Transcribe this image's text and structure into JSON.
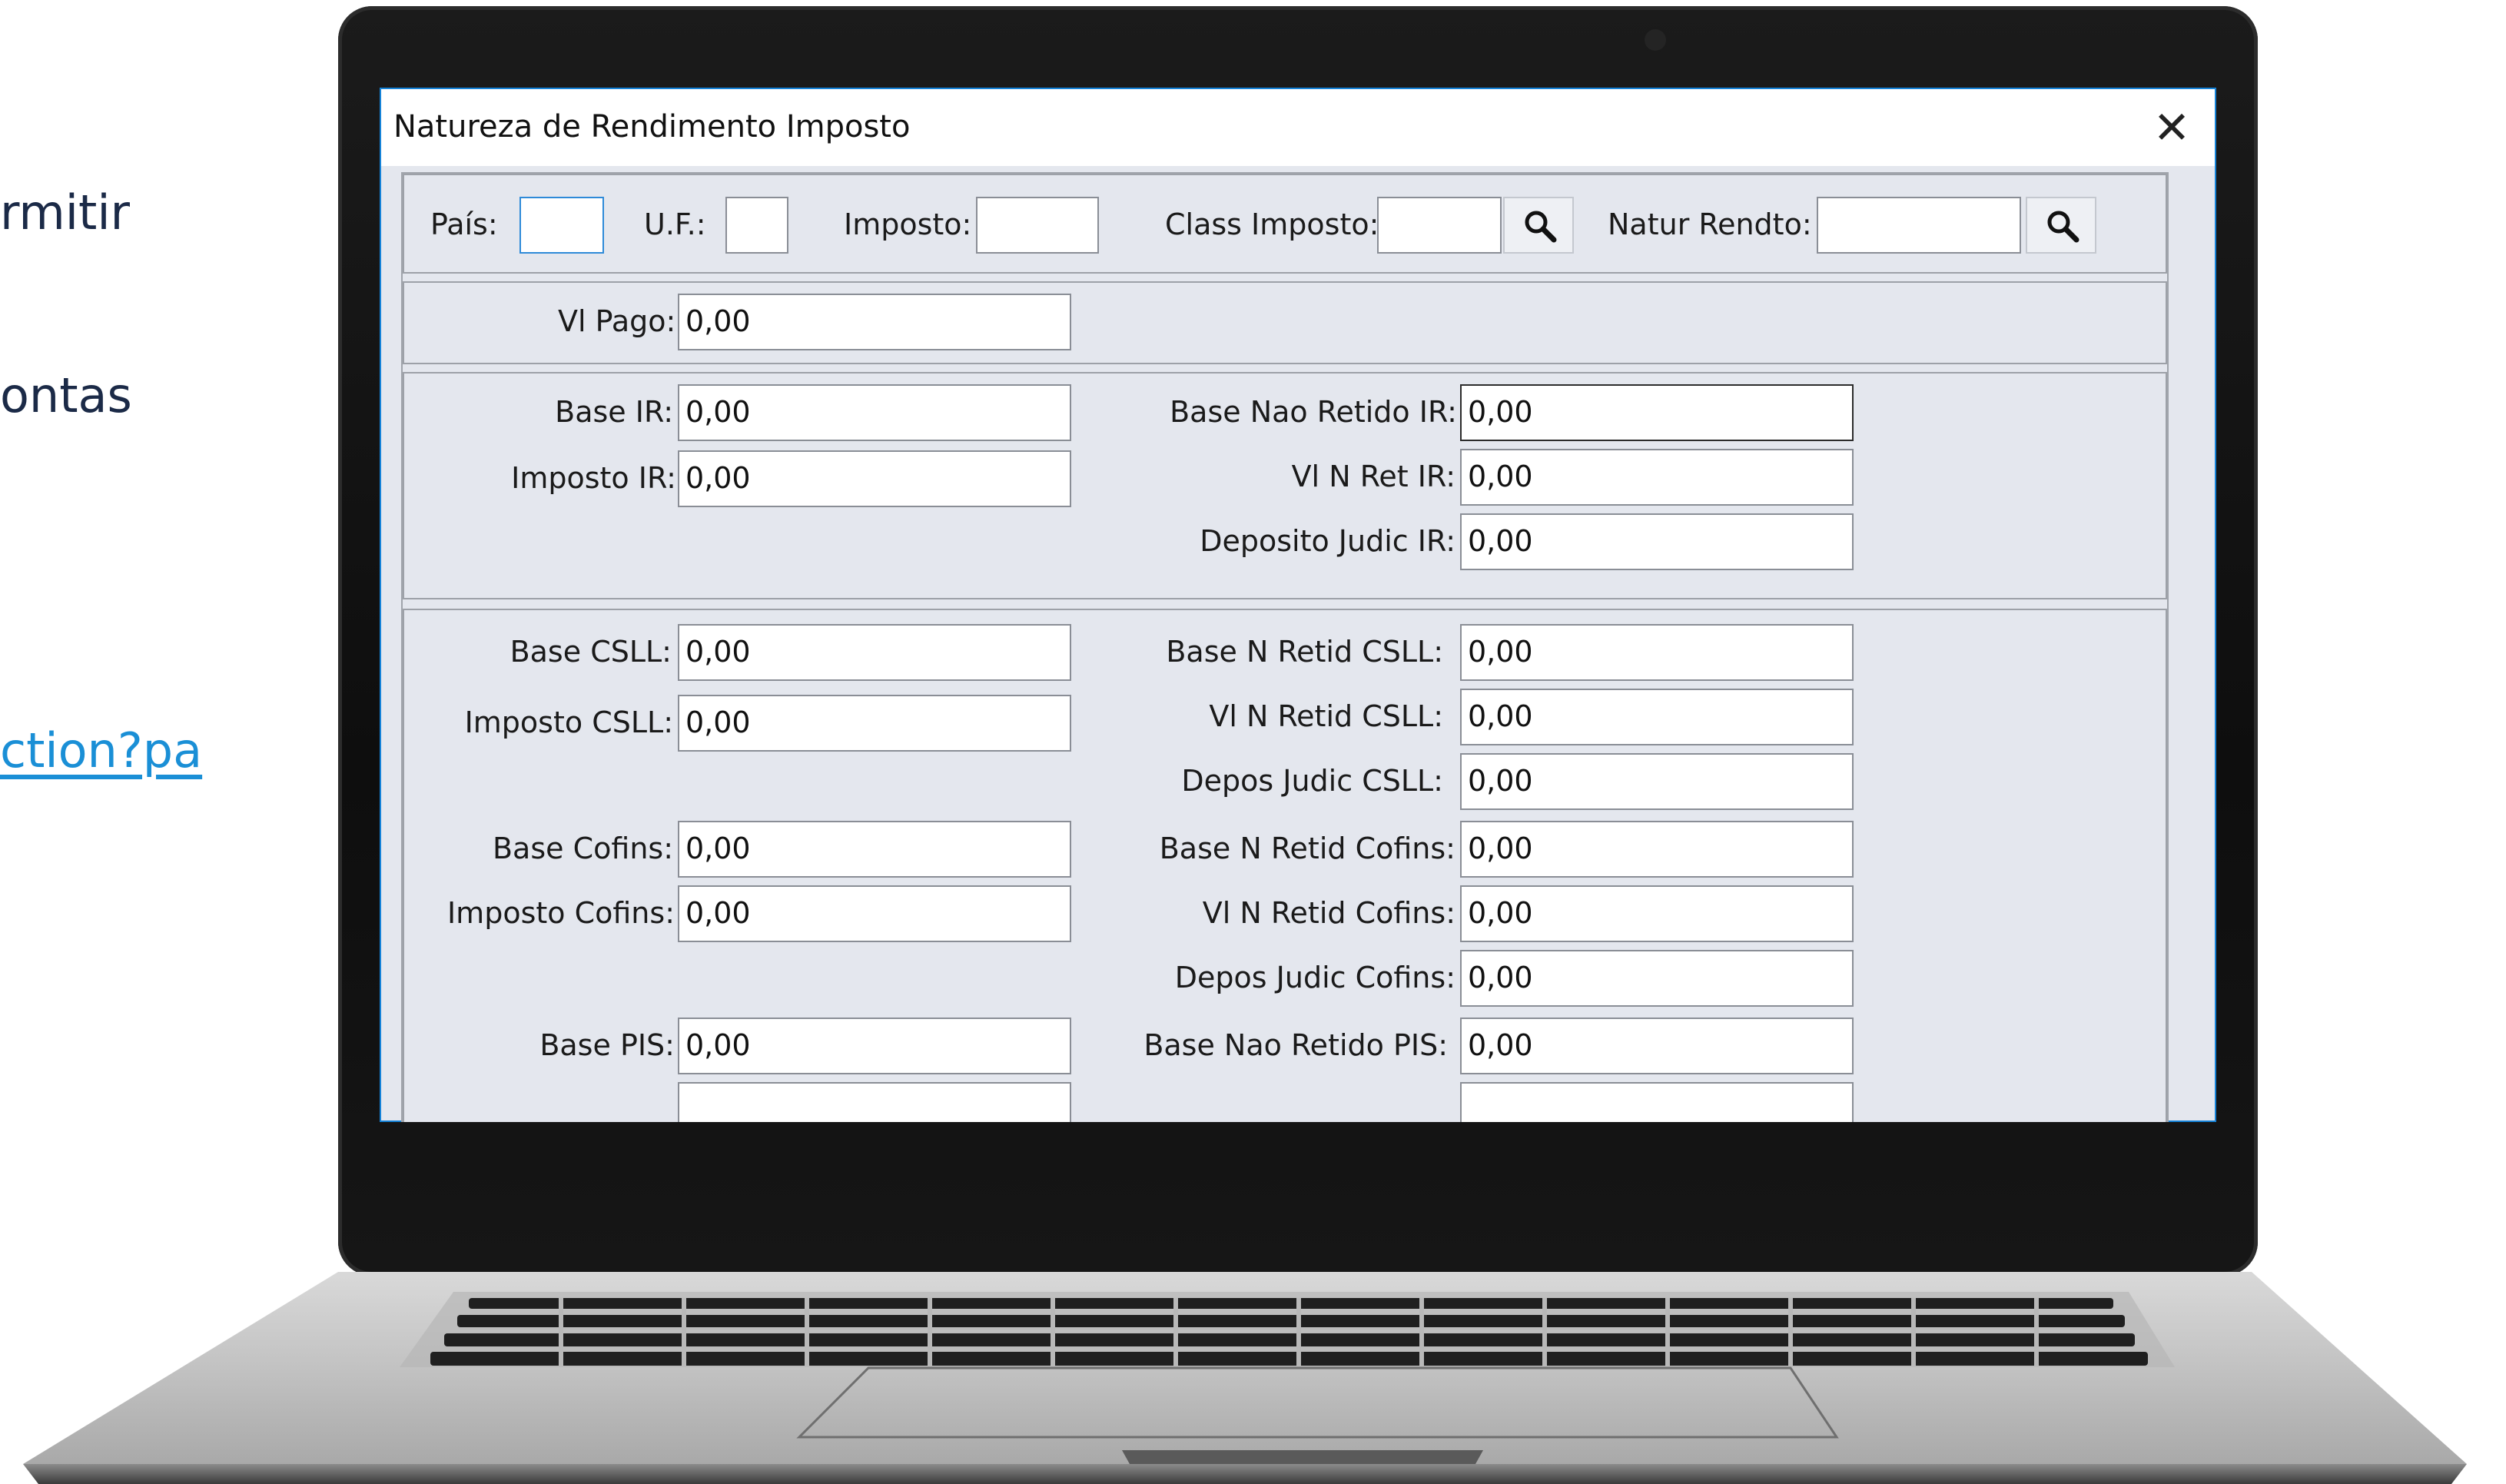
{
  "background_text": {
    "line1": "rmitir",
    "line2": "ontas",
    "link": "ction?pa"
  },
  "window": {
    "title": "Natureza de Rendimento Imposto",
    "close_symbol": "✕"
  },
  "top_filters": {
    "pais": {
      "label": "País:",
      "value": ""
    },
    "uf": {
      "label": "U.F.:",
      "value": ""
    },
    "imposto": {
      "label": "Imposto:",
      "value": ""
    },
    "class_imposto": {
      "label": "Class Imposto:",
      "value": ""
    },
    "natur_rendto": {
      "label": "Natur Rendto:",
      "value": ""
    }
  },
  "vl_pago": {
    "label": "Vl Pago:",
    "value": "0,00"
  },
  "ir": {
    "base_ir": {
      "label": "Base IR:",
      "value": "0,00"
    },
    "imposto_ir": {
      "label": "Imposto IR:",
      "value": "0,00"
    },
    "base_nao_retido_ir": {
      "label": "Base Nao Retido IR:",
      "value": "0,00"
    },
    "vl_n_ret_ir": {
      "label": "Vl N Ret IR:",
      "value": "0,00"
    },
    "deposito_judic_ir": {
      "label": "Deposito Judic IR:",
      "value": "0,00"
    }
  },
  "outros": {
    "base_csll": {
      "label": "Base CSLL:",
      "value": "0,00"
    },
    "imposto_csll": {
      "label": "Imposto CSLL:",
      "value": "0,00"
    },
    "base_n_retid_csll": {
      "label": "Base N Retid CSLL:",
      "value": "0,00"
    },
    "vl_n_retid_csll": {
      "label": "Vl N Retid CSLL:",
      "value": "0,00"
    },
    "depos_judic_csll": {
      "label": "Depos Judic CSLL:",
      "value": "0,00"
    },
    "base_cofins": {
      "label": "Base Cofins:",
      "value": "0,00"
    },
    "imposto_cofins": {
      "label": "Imposto Cofins:",
      "value": "0,00"
    },
    "base_n_retid_cofins": {
      "label": "Base N Retid Cofins:",
      "value": "0,00"
    },
    "vl_n_retid_cofins": {
      "label": "Vl N Retid Cofins:",
      "value": "0,00"
    },
    "depos_judic_cofins": {
      "label": "Depos Judic Cofins:",
      "value": "0,00"
    },
    "base_pis": {
      "label": "Base PIS:",
      "value": "0,00"
    },
    "base_nao_retido_pis": {
      "label": "Base Nao Retido PIS:",
      "value": "0,00"
    }
  },
  "icons": {
    "search": "magnifier-icon",
    "close": "close-icon"
  }
}
